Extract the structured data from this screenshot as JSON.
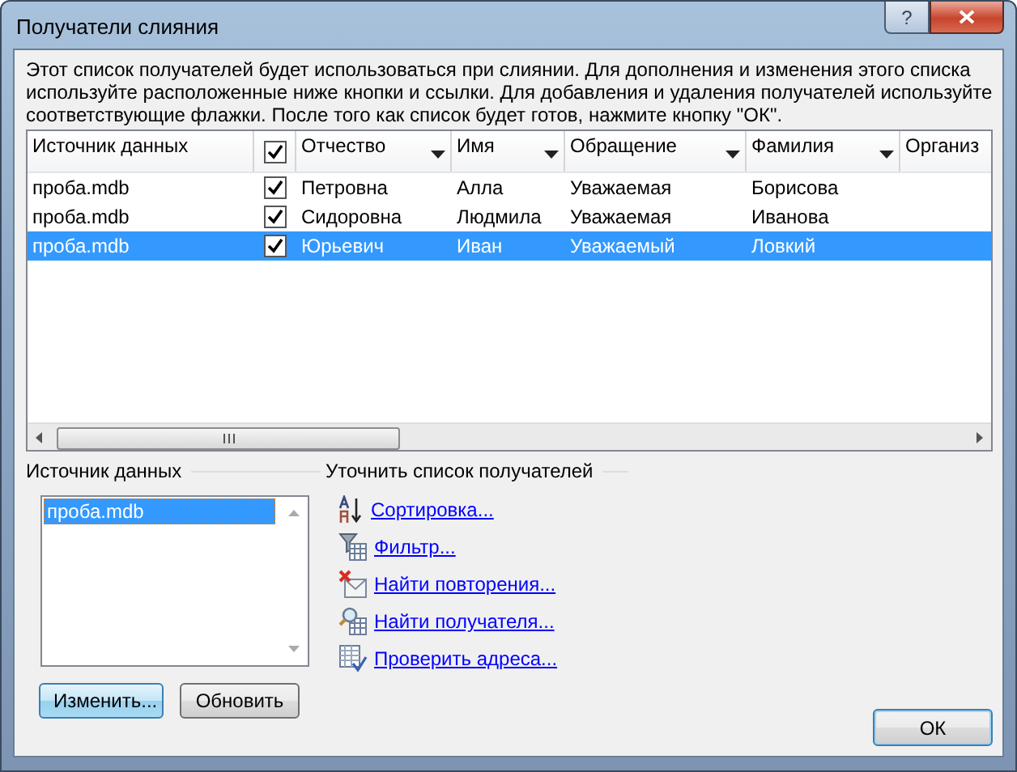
{
  "window": {
    "title": "Получатели слияния",
    "help": "?"
  },
  "intro": "Этот список получателей будет использоваться при слиянии. Для дополнения и изменения этого списка используйте расположенные ниже кнопки и ссылки. Для добавления и удаления получателей используйте соответствующие флажки. После того как список будет готов, нажмите кнопку \"ОК\".",
  "table": {
    "columns": [
      {
        "kind": "text",
        "label": "Источник данных",
        "filter": false
      },
      {
        "kind": "check",
        "checked": true
      },
      {
        "kind": "text",
        "label": "Отчество",
        "filter": true
      },
      {
        "kind": "text",
        "label": "Имя",
        "filter": true
      },
      {
        "kind": "text",
        "label": "Обращение",
        "filter": true
      },
      {
        "kind": "text",
        "label": "Фамилия",
        "filter": true
      },
      {
        "kind": "text",
        "label": "Организ",
        "filter": false
      }
    ],
    "rows": [
      {
        "selected": false,
        "checked": true,
        "cells": [
          "проба.mdb",
          "",
          "Петровна",
          "Алла",
          "Уважаемая",
          "Борисова"
        ]
      },
      {
        "selected": false,
        "checked": true,
        "cells": [
          "проба.mdb",
          "",
          "Сидоровна",
          "Людмила",
          "Уважаемая",
          "Иванова"
        ]
      },
      {
        "selected": true,
        "checked": true,
        "cells": [
          "проба.mdb",
          "",
          "Юрьевич",
          "Иван",
          "Уважаемый",
          "Ловкий"
        ]
      }
    ]
  },
  "source": {
    "title": "Источник данных",
    "items": [
      {
        "label": "проба.mdb",
        "selected": true
      }
    ],
    "buttons": [
      "Изменить...",
      "Обновить"
    ]
  },
  "refine": {
    "title": "Уточнить список получателей",
    "links": [
      {
        "kind": "sort",
        "label": "Сортировка..."
      },
      {
        "kind": "filter",
        "label": "Фильтр..."
      },
      {
        "kind": "duplicates",
        "label": "Найти повторения..."
      },
      {
        "kind": "find",
        "label": "Найти получателя..."
      },
      {
        "kind": "validate",
        "label": "Проверить адреса..."
      }
    ]
  },
  "ok": "ОК"
}
